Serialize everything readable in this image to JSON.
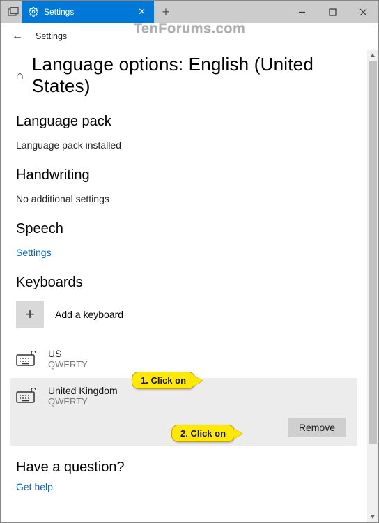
{
  "watermark": "TenForums.com",
  "window": {
    "tab_label": "Settings",
    "sub_label": "Settings"
  },
  "page": {
    "title": "Language options: English (United States)"
  },
  "sections": {
    "language_pack": {
      "heading": "Language pack",
      "status": "Language pack installed"
    },
    "handwriting": {
      "heading": "Handwriting",
      "status": "No additional settings"
    },
    "speech": {
      "heading": "Speech",
      "link": "Settings"
    },
    "keyboards": {
      "heading": "Keyboards",
      "add_label": "Add a keyboard"
    }
  },
  "keyboards": [
    {
      "name": "US",
      "layout": "QWERTY",
      "selected": false
    },
    {
      "name": "United Kingdom",
      "layout": "QWERTY",
      "selected": true
    }
  ],
  "actions": {
    "remove": "Remove"
  },
  "annotations": {
    "callout1": "1. Click on",
    "callout2": "2. Click on"
  },
  "help": {
    "heading": "Have a question?",
    "link": "Get help"
  }
}
